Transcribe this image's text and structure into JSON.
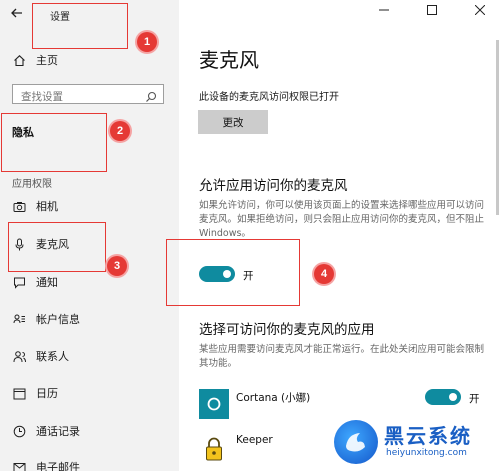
{
  "window": {
    "title": "设置",
    "back_icon": "back-arrow-icon",
    "controls": [
      "minimize",
      "maximize",
      "close"
    ]
  },
  "sidebar": {
    "home": {
      "label": "主页",
      "icon": "home-icon"
    },
    "search": {
      "placeholder": "查找设置",
      "icon": "search-icon"
    },
    "section_title": "隐私",
    "group_label": "应用权限",
    "items": [
      {
        "label": "相机",
        "icon": "camera-icon"
      },
      {
        "label": "麦克风",
        "icon": "microphone-icon",
        "selected": true
      },
      {
        "label": "通知",
        "icon": "notification-icon"
      },
      {
        "label": "帐户信息",
        "icon": "account-info-icon"
      },
      {
        "label": "联系人",
        "icon": "contacts-icon"
      },
      {
        "label": "日历",
        "icon": "calendar-icon"
      },
      {
        "label": "通话记录",
        "icon": "call-history-icon"
      },
      {
        "label": "电子邮件",
        "icon": "email-icon"
      }
    ]
  },
  "main": {
    "title": "麦克风",
    "status": "此设备的麦克风访问权限已打开",
    "change_button": "更改",
    "allow_section": {
      "heading": "允许应用访问你的麦克风",
      "description": "如果允许访问，你可以使用该页面上的设置来选择哪些应用可以访问麦克风。如果拒绝访问，则只会阻止应用访问你的麦克风，但不阻止 Windows。",
      "toggle_on": true,
      "toggle_label": "开"
    },
    "choose_section": {
      "heading": "选择可访问你的麦克风的应用",
      "description": "某些应用需要访问麦克风才能正常运行。在此处关闭应用可能会限制其功能。",
      "apps": [
        {
          "name": "Cortana (小娜)",
          "icon": "cortana-icon",
          "icon_bg": "#0f8b9f",
          "toggle_on": true,
          "toggle_label": "开"
        },
        {
          "name": "Keeper",
          "icon": "keeper-lock-icon",
          "icon_bg": "#ffffff"
        }
      ]
    }
  },
  "annotations": [
    "1",
    "2",
    "3",
    "4"
  ],
  "watermark": {
    "brand": "黑云系统",
    "url": "heiyunxitong.com"
  },
  "colors": {
    "accent": "#0f8b9f",
    "annotation": "#e53935",
    "sidebar_bg": "#f2f2f2",
    "watermark": "#1a5fc4"
  }
}
